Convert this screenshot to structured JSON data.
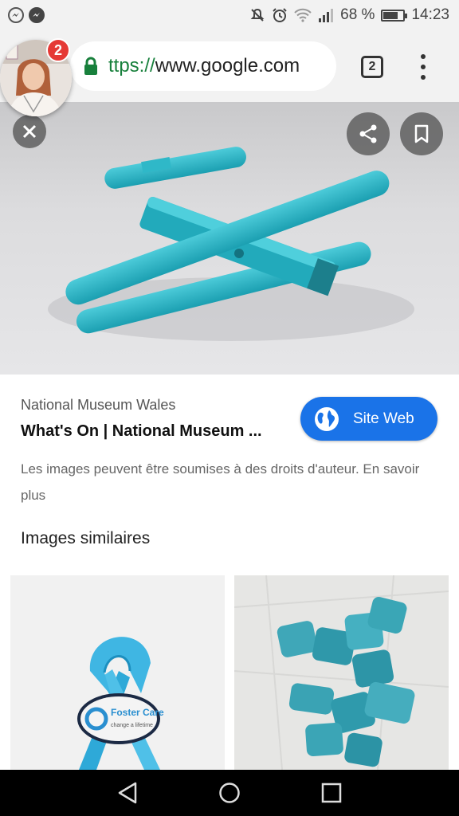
{
  "status_bar": {
    "battery_percent": "68 %",
    "battery_level": 0.68,
    "time": "14:23",
    "icons": [
      "messenger-icon",
      "messenger-icon",
      "mute-icon",
      "alarm-icon",
      "wifi-icon",
      "signal-icon",
      "battery-icon"
    ]
  },
  "browser": {
    "url_scheme": "ttps://",
    "url_host": "www.google.com",
    "tab_count": "2"
  },
  "chat_head": {
    "badge_count": "2"
  },
  "result": {
    "source": "National Museum Wales",
    "title": "What's On | National Museum ...",
    "site_button": "Site Web",
    "copyright": "Les images peuvent être soumises à des droits d'auteur. En savoir plus"
  },
  "similar": {
    "title": "Images similaires",
    "thumb1_label_line1": "Foster Care",
    "thumb1_label_line2": "change a lifetime"
  },
  "colors": {
    "accent": "#1a73e8",
    "lock": "#18803c",
    "badge": "#e53935",
    "craft": "#25b4c6"
  }
}
